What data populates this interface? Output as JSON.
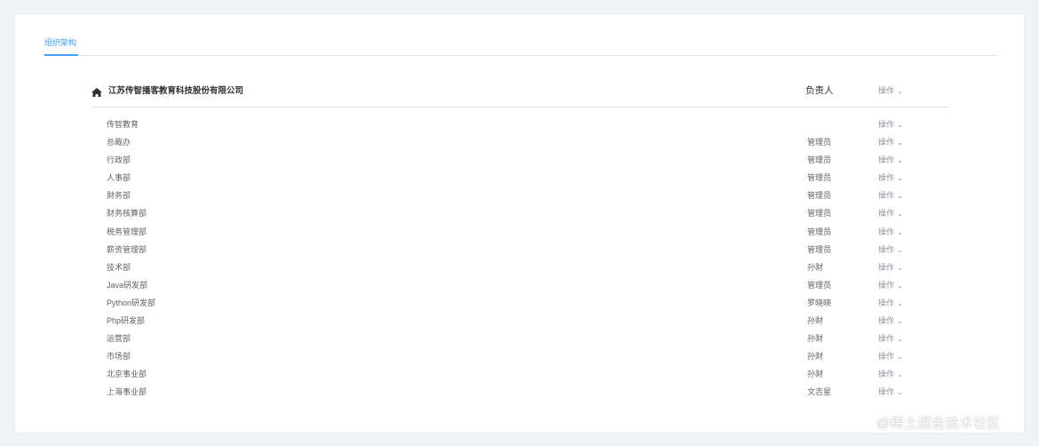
{
  "tabs": [
    {
      "label": "组织架构"
    }
  ],
  "tree": {
    "company": "江苏传智播客教育科技股份有限公司",
    "manager_header": "负责人",
    "operation_label": "操作",
    "departments": [
      {
        "name": "传智教育",
        "manager": ""
      },
      {
        "name": "总裁办",
        "manager": "管理员"
      },
      {
        "name": "行政部",
        "manager": "管理员"
      },
      {
        "name": "人事部",
        "manager": "管理员"
      },
      {
        "name": "财务部",
        "manager": "管理员"
      },
      {
        "name": "财务核算部",
        "manager": "管理员"
      },
      {
        "name": "税务管理部",
        "manager": "管理员"
      },
      {
        "name": "薪资管理部",
        "manager": "管理员"
      },
      {
        "name": "技术部",
        "manager": "孙财"
      },
      {
        "name": "Java研发部",
        "manager": "管理员"
      },
      {
        "name": "Python研发部",
        "manager": "罗晓晓"
      },
      {
        "name": "Php研发部",
        "manager": "孙财"
      },
      {
        "name": "运营部",
        "manager": "孙财"
      },
      {
        "name": "市场部",
        "manager": "孙财"
      },
      {
        "name": "北京事业部",
        "manager": "孙财"
      },
      {
        "name": "上海事业部",
        "manager": "文吉星"
      }
    ]
  },
  "watermark": "@稀土掘金技术社区",
  "colors": {
    "accent": "#409eff",
    "background": "#f0f2f5"
  },
  "icons": {
    "home": "home-icon",
    "dropdown": "chevron-down-icon"
  }
}
